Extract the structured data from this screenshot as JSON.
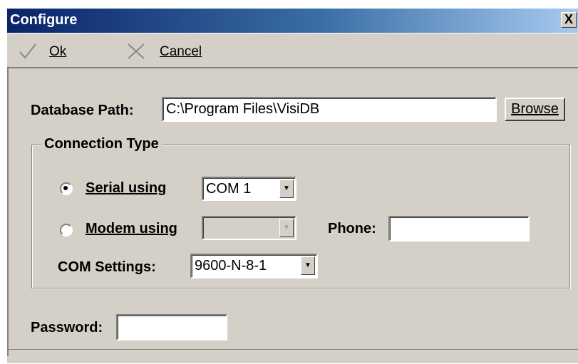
{
  "window": {
    "title": "Configure",
    "close_glyph": "X"
  },
  "toolbar": {
    "ok_label": "Ok",
    "cancel_label": "Cancel",
    "ok_icon": "checkmark-icon",
    "cancel_icon": "x-icon"
  },
  "form": {
    "database_path_label": "Database Path:",
    "database_path_value": "C:\\Program Files\\VisiDB",
    "browse_label": "Browse",
    "connection_type_label": "Connection Type",
    "serial_label": "Serial using",
    "serial_selected": true,
    "serial_port_value": "COM 1",
    "modem_label": "Modem using",
    "modem_selected": false,
    "modem_value": "",
    "phone_label": "Phone:",
    "phone_value": "",
    "com_settings_label": "COM Settings:",
    "com_settings_value": "9600-N-8-1",
    "password_label": "Password:",
    "password_value": ""
  },
  "colors": {
    "titlebar_start": "#0a246a",
    "titlebar_end": "#a6caf0",
    "face": "#d4d0c8"
  }
}
